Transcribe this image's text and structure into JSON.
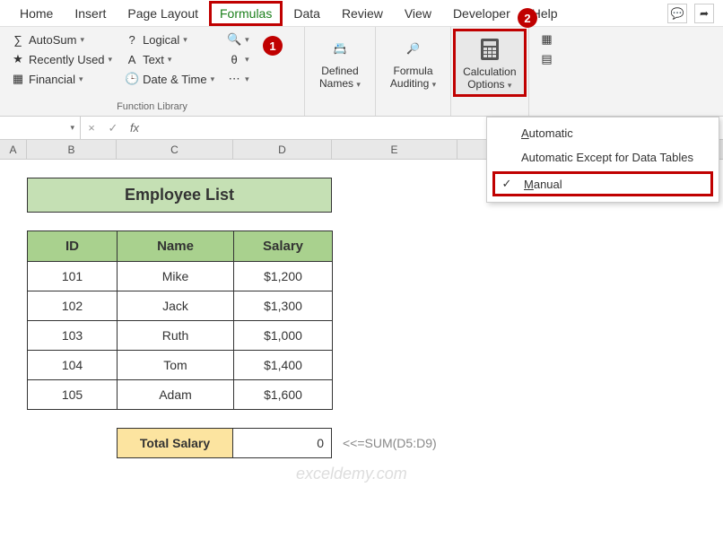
{
  "tabs": [
    "Home",
    "Insert",
    "Page Layout",
    "Formulas",
    "Data",
    "Review",
    "View",
    "Developer",
    "Help"
  ],
  "active_tab": "Formulas",
  "ribbon": {
    "func_lib": {
      "autosum": "AutoSum",
      "recent": "Recently Used",
      "financial": "Financial",
      "logical": "Logical",
      "text": "Text",
      "datetime": "Date & Time",
      "label": "Function Library"
    },
    "defined": {
      "label1": "Defined",
      "label2": "Names"
    },
    "auditing": {
      "label1": "Formula",
      "label2": "Auditing"
    },
    "calc": {
      "label1": "Calculation",
      "label2": "Options"
    }
  },
  "menu": {
    "automatic": "Automatic",
    "auto_except": "Automatic Except for Data Tables",
    "manual": "Manual"
  },
  "callouts": {
    "one": "1",
    "two": "2"
  },
  "formula_bar": {
    "fx": "fx"
  },
  "columns": [
    "A",
    "B",
    "C",
    "D",
    "E"
  ],
  "sheet": {
    "title": "Employee List",
    "headers": {
      "id": "ID",
      "name": "Name",
      "salary": "Salary"
    },
    "rows": [
      {
        "id": "101",
        "name": "Mike",
        "salary": "$1,200"
      },
      {
        "id": "102",
        "name": "Jack",
        "salary": "$1,300"
      },
      {
        "id": "103",
        "name": "Ruth",
        "salary": "$1,000"
      },
      {
        "id": "104",
        "name": "Tom",
        "salary": "$1,400"
      },
      {
        "id": "105",
        "name": "Adam",
        "salary": "$1,600"
      }
    ],
    "total_label": "Total Salary",
    "total_value": "0",
    "total_note": "<<=SUM(D5:D9)"
  },
  "watermark": "exceldemy.com"
}
